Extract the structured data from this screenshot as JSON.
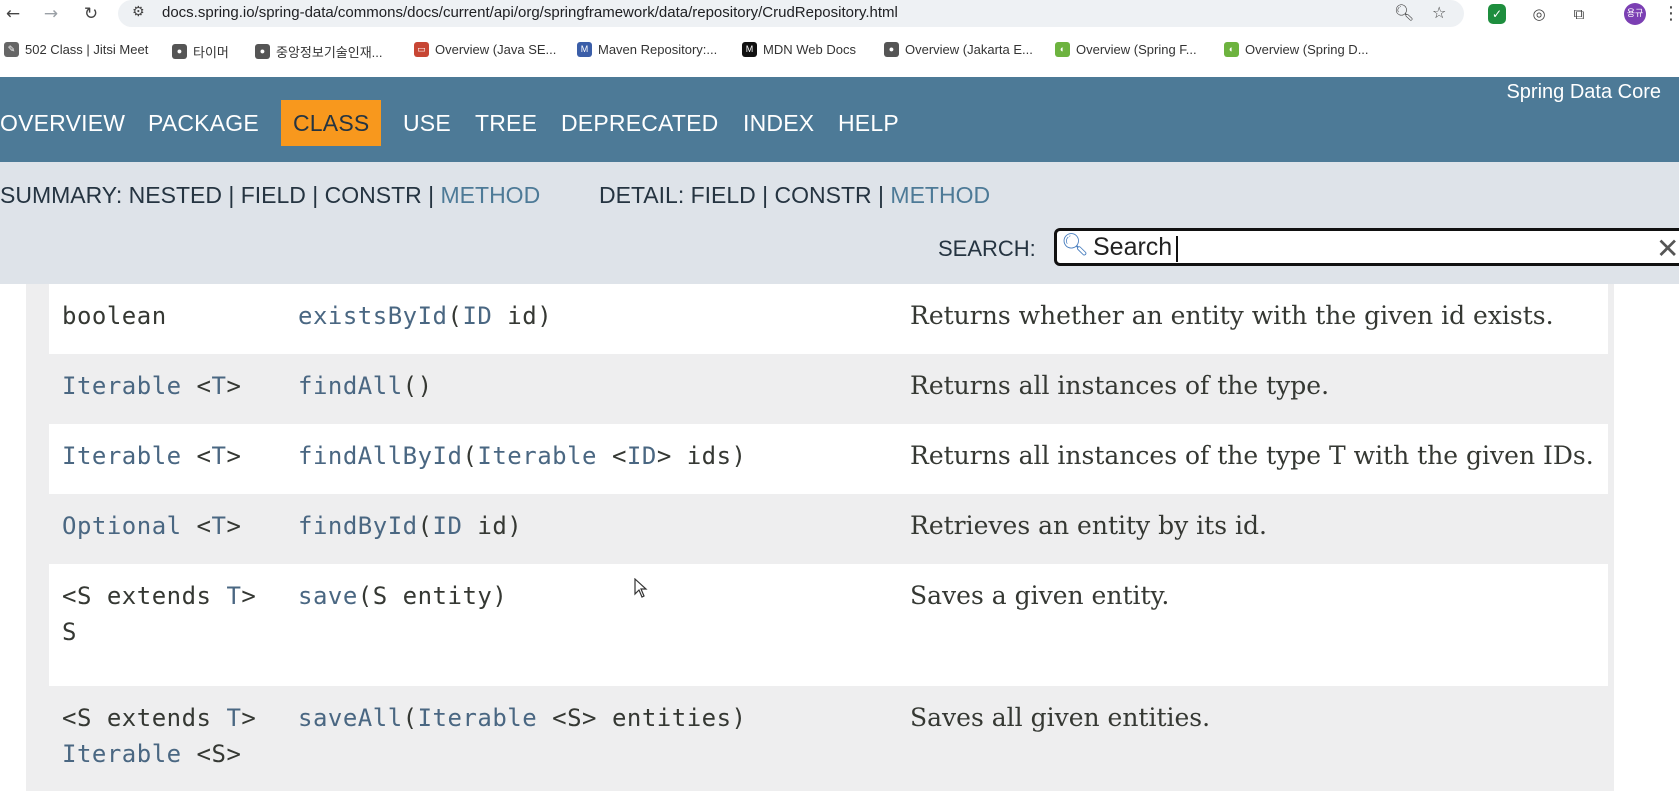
{
  "browser": {
    "back_icon": "arrow-left-icon",
    "url": "docs.spring.io/spring-data/commons/docs/current/api/org/springframework/data/repository/CrudRepository.html",
    "bookmarks": [
      {
        "label": "502 Class | Jitsi Meet",
        "icon": "jitsi-icon"
      },
      {
        "label": "타이머",
        "icon": "globe-icon"
      },
      {
        "label": "중앙정보기술인재...",
        "icon": "globe-icon"
      },
      {
        "label": "Overview (Java SE...",
        "icon": "oracle-icon"
      },
      {
        "label": "Maven Repository:...",
        "icon": "mvn-icon"
      },
      {
        "label": "MDN Web Docs",
        "icon": "mdn-icon"
      },
      {
        "label": "Overview (Jakarta E...",
        "icon": "globe-icon"
      },
      {
        "label": "Overview (Spring F...",
        "icon": "spring-icon"
      },
      {
        "label": "Overview (Spring D...",
        "icon": "spring-icon"
      }
    ],
    "avatar_text": "용규"
  },
  "header": {
    "brand": "Spring Data Core",
    "nav": [
      "OVERVIEW",
      "PACKAGE",
      "CLASS",
      "USE",
      "TREE",
      "DEPRECATED",
      "INDEX",
      "HELP"
    ],
    "active_nav": "CLASS"
  },
  "subnav": {
    "summary_prefix": "SUMMARY: NESTED | FIELD | CONSTR | ",
    "summary_method": "METHOD",
    "detail_prefix": "DETAIL: FIELD | CONSTR | ",
    "detail_method": "METHOD",
    "search_label": "SEARCH:",
    "search_placeholder": "Search",
    "search_value": "Search"
  },
  "methods": [
    {
      "modifier": [
        {
          "t": "boolean",
          "link": false
        }
      ],
      "modifier2": [],
      "method": [
        {
          "t": "existsById",
          "link": true
        },
        {
          "t": "(",
          "link": false
        },
        {
          "t": "ID",
          "link": true
        },
        {
          "t": " id)",
          "link": false
        }
      ],
      "description": "Returns whether an entity with the given id exists."
    },
    {
      "modifier": [
        {
          "t": "Iterable",
          "link": true
        },
        {
          "t": " <",
          "link": false
        },
        {
          "t": "T",
          "link": true
        },
        {
          "t": ">",
          "link": false
        }
      ],
      "modifier2": [],
      "method": [
        {
          "t": "findAll",
          "link": true
        },
        {
          "t": "()",
          "link": false
        }
      ],
      "description": "Returns all instances of the type."
    },
    {
      "modifier": [
        {
          "t": "Iterable",
          "link": true
        },
        {
          "t": " <",
          "link": false
        },
        {
          "t": "T",
          "link": true
        },
        {
          "t": ">",
          "link": false
        }
      ],
      "modifier2": [],
      "method": [
        {
          "t": "findAllById",
          "link": true
        },
        {
          "t": "(",
          "link": false
        },
        {
          "t": "Iterable",
          "link": true
        },
        {
          "t": " <",
          "link": false
        },
        {
          "t": "ID",
          "link": true
        },
        {
          "t": "> ids)",
          "link": false
        }
      ],
      "description": "Returns all instances of the type T with the given IDs."
    },
    {
      "modifier": [
        {
          "t": "Optional",
          "link": true
        },
        {
          "t": " <",
          "link": false
        },
        {
          "t": "T",
          "link": true
        },
        {
          "t": ">",
          "link": false
        }
      ],
      "modifier2": [],
      "method": [
        {
          "t": "findById",
          "link": true
        },
        {
          "t": "(",
          "link": false
        },
        {
          "t": "ID",
          "link": true
        },
        {
          "t": " id)",
          "link": false
        }
      ],
      "description": "Retrieves an entity by its id."
    },
    {
      "modifier": [
        {
          "t": "<S extends ",
          "link": false
        },
        {
          "t": "T",
          "link": true
        },
        {
          "t": ">",
          "link": false
        }
      ],
      "modifier2": [
        {
          "t": "S",
          "link": false
        }
      ],
      "method": [
        {
          "t": "save",
          "link": true
        },
        {
          "t": "(S entity)",
          "link": false
        }
      ],
      "description": "Saves a given entity."
    },
    {
      "modifier": [
        {
          "t": "<S extends ",
          "link": false
        },
        {
          "t": "T",
          "link": true
        },
        {
          "t": ">",
          "link": false
        }
      ],
      "modifier2": [
        {
          "t": "Iterable",
          "link": true
        },
        {
          "t": " <S>",
          "link": false
        }
      ],
      "method": [
        {
          "t": "saveAll",
          "link": true
        },
        {
          "t": "(",
          "link": false
        },
        {
          "t": "Iterable",
          "link": true
        },
        {
          "t": " <S> entities)",
          "link": false
        }
      ],
      "description": "Saves all given entities."
    }
  ]
}
